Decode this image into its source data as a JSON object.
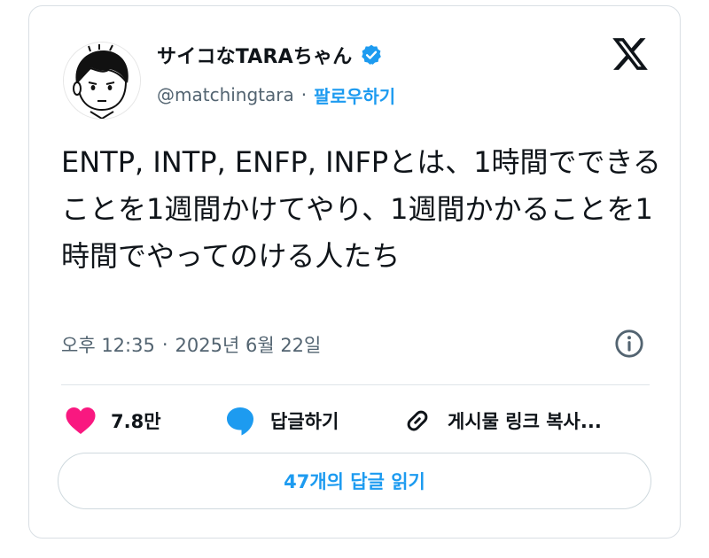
{
  "author": {
    "display_name": "サイコなTARAちゃん",
    "handle": "@matchingtara",
    "separator": "·",
    "follow_label": "팔로우하기",
    "avatar_icon": "cartoon-boy-avatar",
    "verified_icon": "verified-badge-icon"
  },
  "brand": {
    "logo_icon": "x-logo-icon"
  },
  "tweet": {
    "text": "ENTP, INTP, ENFP, INFPとは、1時間でできることを1週間かけてやり、1週間かかることを1時間でやってのける人たち",
    "time": "오후 12:35",
    "separator": "·",
    "date": "2025년 6월 22일"
  },
  "actions": {
    "like_count": "7.8만",
    "reply_label": "답글하기",
    "copy_link_label": "게시물 링크 복사..."
  },
  "footer": {
    "read_replies_label": "47개의 답글 읽기"
  },
  "colors": {
    "accent": "#1d9bf0",
    "like": "#f91880",
    "text": "#0f1419",
    "secondary": "#536471",
    "border": "#d9dfe4"
  }
}
